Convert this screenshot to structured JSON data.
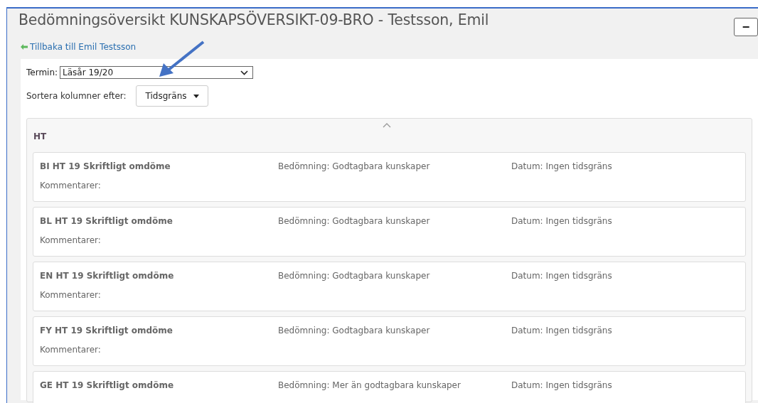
{
  "title": "Bedömningsöversikt KUNSKAPSÖVERSIKT-09-BRO - Testsson, Emil",
  "collapse_button": "−",
  "back_link": "Tillbaka till Emil Testsson",
  "term": {
    "label": "Termin:",
    "value": "Läsår 19/20"
  },
  "sort": {
    "label": "Sortera kolumner efter:",
    "value": "Tidsgräns"
  },
  "group": {
    "title": "HT",
    "expanded": true,
    "cards": [
      {
        "name": "BI HT 19 Skriftligt omdöme",
        "grade": "Bedömning: Godtagbara kunskaper",
        "date": "Datum: Ingen tidsgräns",
        "comments": "Kommentarer:"
      },
      {
        "name": "BL HT 19 Skriftligt omdöme",
        "grade": "Bedömning: Godtagbara kunskaper",
        "date": "Datum: Ingen tidsgräns",
        "comments": "Kommentarer:"
      },
      {
        "name": "EN HT 19 Skriftligt omdöme",
        "grade": "Bedömning: Godtagbara kunskaper",
        "date": "Datum: Ingen tidsgräns",
        "comments": "Kommentarer:"
      },
      {
        "name": "FY HT 19 Skriftligt omdöme",
        "grade": "Bedömning: Godtagbara kunskaper",
        "date": "Datum: Ingen tidsgräns",
        "comments": "Kommentarer:"
      },
      {
        "name": "GE HT 19 Skriftligt omdöme",
        "grade": "Bedömning: Mer än godtagbara kunskaper",
        "date": "Datum: Ingen tidsgräns"
      }
    ]
  }
}
